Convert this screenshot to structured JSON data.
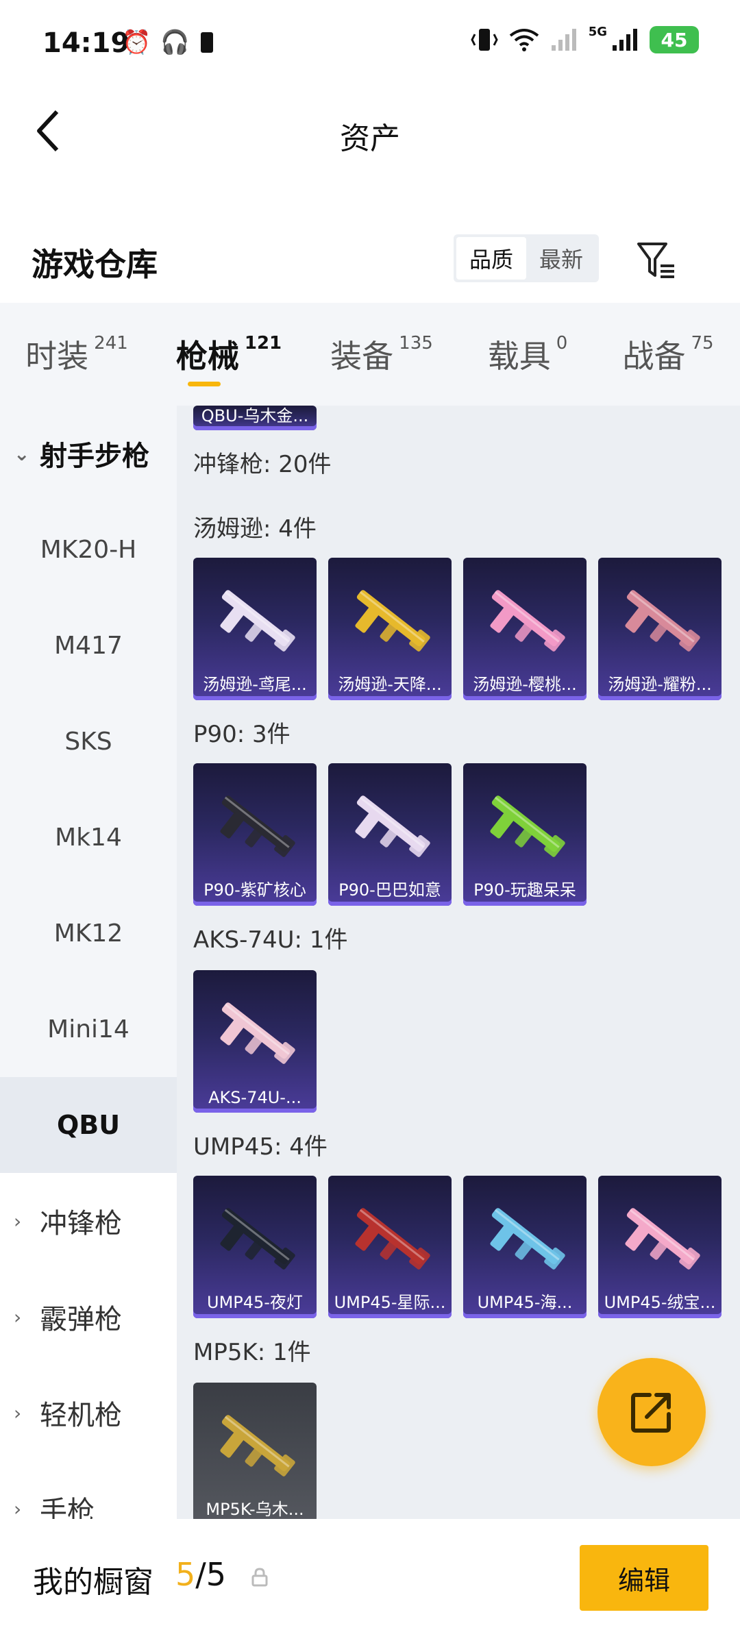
{
  "status_bar": {
    "time": "14:19",
    "network_label": "5G",
    "battery": "45"
  },
  "header": {
    "title": "资产"
  },
  "warehouse": {
    "title": "游戏仓库",
    "sort_options": [
      "品质",
      "最新"
    ],
    "active_sort": "品质"
  },
  "tabs": [
    {
      "label": "时装",
      "count": "241"
    },
    {
      "label": "枪械",
      "count": "121",
      "active": true
    },
    {
      "label": "装备",
      "count": "135"
    },
    {
      "label": "载具",
      "count": "0"
    },
    {
      "label": "战备",
      "count": "75"
    }
  ],
  "sidebar": {
    "open_group": "射手步枪",
    "sub_items": [
      "MK20-H",
      "M417",
      "SKS",
      "Mk14",
      "MK12",
      "Mini14",
      "QBU"
    ],
    "selected": "QBU",
    "groups": [
      "冲锋枪",
      "霰弹枪",
      "轻机枪",
      "手枪"
    ]
  },
  "content": {
    "partial_card": "QBU-乌木金...",
    "category_total": "冲锋枪: 20件",
    "sections": [
      {
        "label": "汤姆逊: 4件",
        "items": [
          "汤姆逊-鸢尾...",
          "汤姆逊-天降...",
          "汤姆逊-樱桃...",
          "汤姆逊-耀粉..."
        ]
      },
      {
        "label": "P90: 3件",
        "items": [
          "P90-紫矿核心",
          "P90-巴巴如意",
          "P90-玩趣呆呆"
        ]
      },
      {
        "label": "AKS-74U: 1件",
        "items": [
          "AKS-74U-..."
        ]
      },
      {
        "label": "UMP45: 4件",
        "items": [
          "UMP45-夜灯",
          "UMP45-星际...",
          "UMP45-海...",
          "UMP45-绒宝..."
        ]
      },
      {
        "label": "MP5K: 1件",
        "items": [
          "MP5K-乌木..."
        ]
      }
    ],
    "item_colors": {
      "汤姆逊-鸢尾...": "#e8dff2",
      "汤姆逊-天降...": "#e6b92c",
      "汤姆逊-樱桃...": "#f29ac6",
      "汤姆逊-耀粉...": "#d88a9a",
      "P90-紫矿核心": "#2a2a33",
      "P90-巴巴如意": "#e7d9ef",
      "P90-玩趣呆呆": "#7fd13a",
      "AKS-74U-...": "#f0c6d4",
      "UMP45-夜灯": "#1e2430",
      "UMP45-星际...": "#b8322e",
      "UMP45-海...": "#6ec3e8",
      "UMP45-绒宝...": "#f4a9c9",
      "MP5K-乌木...": "#c9a53a"
    }
  },
  "bottom_bar": {
    "label": "我的橱窗",
    "current": "5",
    "total": "/5",
    "edit_label": "编辑"
  },
  "colors": {
    "accent": "#f9b60e",
    "card_bg": "#2b2860",
    "card_edge": "#7a63e8"
  }
}
